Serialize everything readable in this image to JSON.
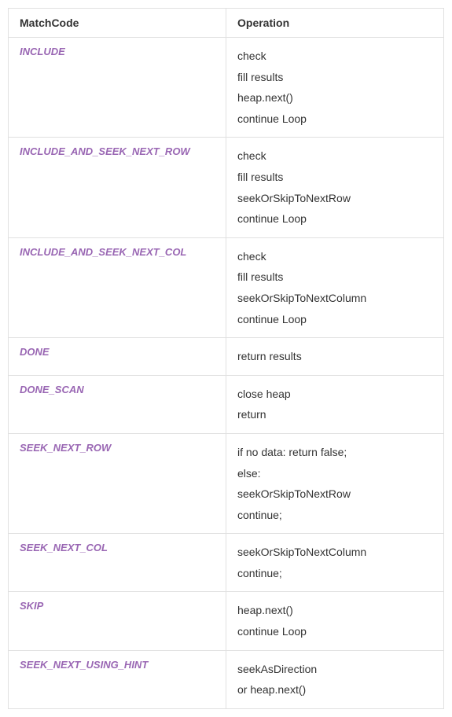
{
  "headers": {
    "col0": "MatchCode",
    "col1": "Operation"
  },
  "rows": [
    {
      "matchcode": "INCLUDE",
      "ops": [
        "check",
        "fill results",
        "heap.next()",
        "continue Loop"
      ]
    },
    {
      "matchcode": "INCLUDE_AND_SEEK_NEXT_ROW",
      "ops": [
        "check",
        "fill results",
        "seekOrSkipToNextRow",
        "continue Loop"
      ]
    },
    {
      "matchcode": "INCLUDE_AND_SEEK_NEXT_COL",
      "ops": [
        "check",
        "fill results",
        "seekOrSkipToNextColumn",
        "continue Loop"
      ]
    },
    {
      "matchcode": "DONE",
      "ops": [
        "return results"
      ]
    },
    {
      "matchcode": "DONE_SCAN",
      "ops": [
        "close heap",
        "return"
      ]
    },
    {
      "matchcode": "SEEK_NEXT_ROW",
      "ops": [
        "if no data: return false;",
        "else:",
        "seekOrSkipToNextRow",
        "continue;"
      ]
    },
    {
      "matchcode": "SEEK_NEXT_COL",
      "ops": [
        "seekOrSkipToNextColumn",
        "continue;"
      ]
    },
    {
      "matchcode": "SKIP",
      "ops": [
        "heap.next()",
        "continue Loop"
      ]
    },
    {
      "matchcode": "SEEK_NEXT_USING_HINT",
      "ops": [
        "seekAsDirection",
        "or heap.next()"
      ]
    }
  ]
}
